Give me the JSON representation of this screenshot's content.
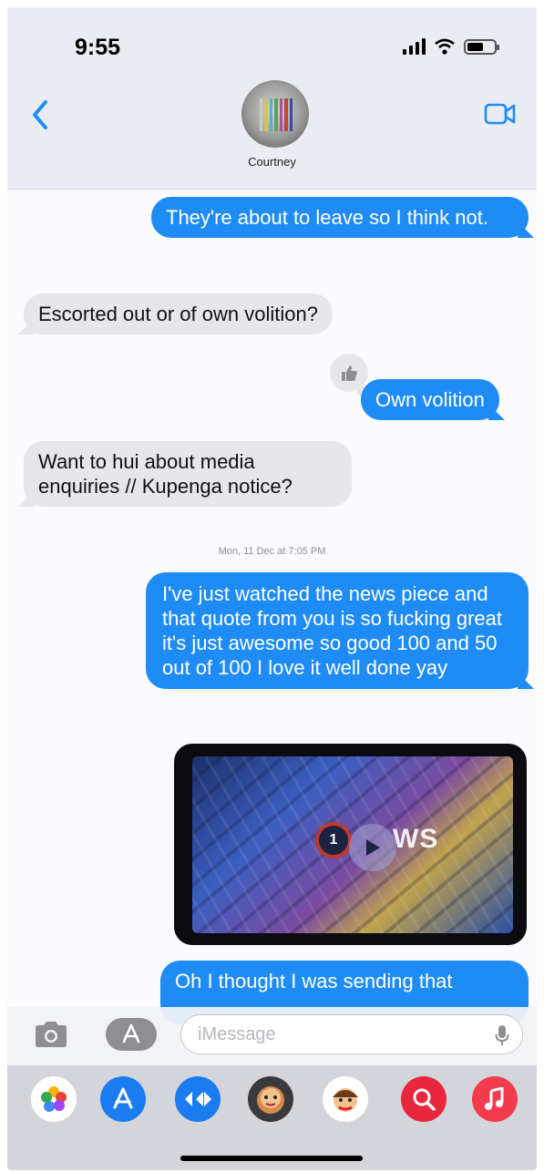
{
  "status_bar": {
    "time": "9:55"
  },
  "header": {
    "contact_name": "Courtney"
  },
  "messages": [
    {
      "text": "They're about to leave so I think not."
    },
    {
      "text": "Escorted out or of own volition?"
    },
    {
      "text": "Own volition"
    },
    {
      "text": "Want to hui about media enquiries // Kupenga notice?"
    },
    {
      "text": "I've just watched the news piece and that quote from you is so fucking great it's just awesome so good 100 and 50 out of 100 I love it well done yay"
    },
    {
      "text": "Oh I thought I was sending that"
    }
  ],
  "timestamp": "Mon, 11 Dec at 7:05 PM",
  "video": {
    "logo_text": "1",
    "word": "WS"
  },
  "input": {
    "placeholder": "iMessage"
  },
  "colors": {
    "outgoing": "#1f8cf5",
    "incoming": "#e6e6eb",
    "accent": "#1f8cf5"
  },
  "icons": [
    "chevron-left-icon",
    "video-camera-icon",
    "thumbs-up-icon",
    "camera-icon",
    "app-store-icon",
    "microphone-icon",
    "photos-icon",
    "app-store-app-icon",
    "digital-touch-icon",
    "memoji-icon",
    "memoji-stickers-icon",
    "image-search-icon",
    "music-icon"
  ]
}
